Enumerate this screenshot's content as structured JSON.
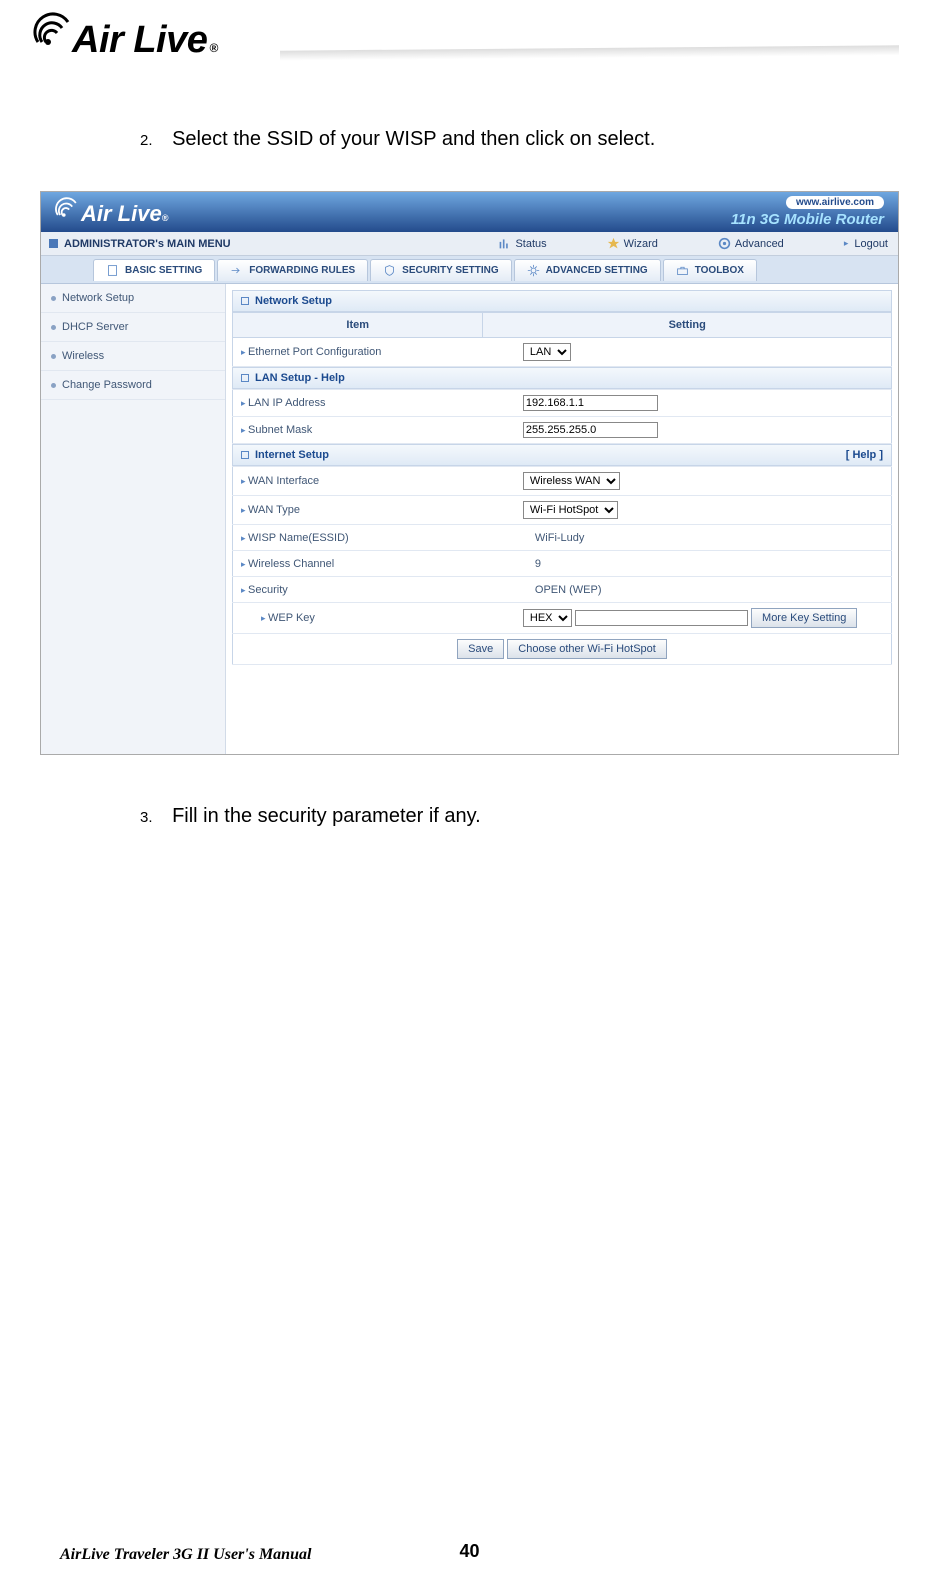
{
  "logo": {
    "text": "Air Live",
    "trademark": "®"
  },
  "instructions": {
    "s2": {
      "num": "2.",
      "text": "Select the SSID of your WISP and then click on select."
    },
    "s3": {
      "num": "3.",
      "text": "Fill in the security parameter if any."
    }
  },
  "router": {
    "brand": "Air Live",
    "brand_tm": "®",
    "url": "www.airlive.com",
    "tagline": "11n 3G Mobile Router",
    "menu_title": "ADMINISTRATOR's MAIN MENU",
    "nav": {
      "status": "Status",
      "wizard": "Wizard",
      "advanced": "Advanced",
      "logout": "Logout"
    },
    "tabs": {
      "basic": "BASIC SETTING",
      "forwarding": "FORWARDING RULES",
      "security": "SECURITY SETTING",
      "advsetting": "ADVANCED SETTING",
      "toolbox": "TOOLBOX"
    },
    "sidebar": {
      "network_setup": "Network Setup",
      "dhcp": "DHCP Server",
      "wireless": "Wireless",
      "changepw": "Change Password"
    },
    "sections": {
      "network": "Network Setup",
      "lan_help": "LAN Setup - Help",
      "internet": "Internet Setup",
      "help": "[ Help ]"
    },
    "headers": {
      "item": "Item",
      "setting": "Setting"
    },
    "rows": {
      "eth_label": "Ethernet Port Configuration",
      "eth_value": "LAN",
      "lanip_label": "LAN IP Address",
      "lanip_value": "192.168.1.1",
      "subnet_label": "Subnet Mask",
      "subnet_value": "255.255.255.0",
      "wanif_label": "WAN Interface",
      "wanif_value": "Wireless WAN",
      "wantype_label": "WAN Type",
      "wantype_value": "Wi-Fi HotSpot",
      "wisp_label": "WISP Name(ESSID)",
      "wisp_value": "WiFi-Ludy",
      "channel_label": "Wireless Channel",
      "channel_value": "9",
      "security_label": "Security",
      "security_value": "OPEN (WEP)",
      "wepkey_label": "WEP Key",
      "wepkey_select": "HEX",
      "wepkey_input": "",
      "more_key": "More Key Setting"
    },
    "buttons": {
      "save": "Save",
      "choose": "Choose other Wi-Fi HotSpot"
    }
  },
  "page_footer": {
    "number": "40",
    "manual": "AirLive Traveler 3G II User's Manual"
  }
}
